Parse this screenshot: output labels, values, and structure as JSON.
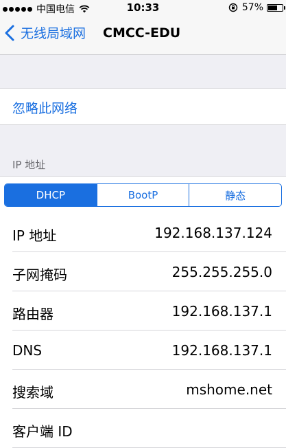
{
  "status_bar": {
    "carrier": "中国电信",
    "time": "10:33",
    "battery_percent": "57%",
    "battery_level": 0.57,
    "signal_bars": 5
  },
  "nav": {
    "back_label": "无线局域网",
    "title": "CMCC-EDU"
  },
  "forget": {
    "label": "忽略此网络"
  },
  "ip_section": {
    "header": "IP 地址",
    "segments": [
      "DHCP",
      "BootP",
      "静态"
    ],
    "selected_segment": "DHCP"
  },
  "rows": [
    {
      "label": "IP 地址",
      "value": "192.168.137.124"
    },
    {
      "label": "子网掩码",
      "value": "255.255.255.0"
    },
    {
      "label": "路由器",
      "value": "192.168.137.1"
    },
    {
      "label": "DNS",
      "value": "192.168.137.1"
    },
    {
      "label": "搜索域",
      "value": "mshome.net"
    },
    {
      "label": "客户端 ID",
      "value": ""
    }
  ],
  "colors": {
    "accent": "#1a6fe0",
    "background": "#efeff4"
  },
  "icons": {
    "back": "chevron-left-icon",
    "wifi": "wifi-icon",
    "rotation_lock": "rotation-lock-icon",
    "battery": "battery-icon"
  }
}
